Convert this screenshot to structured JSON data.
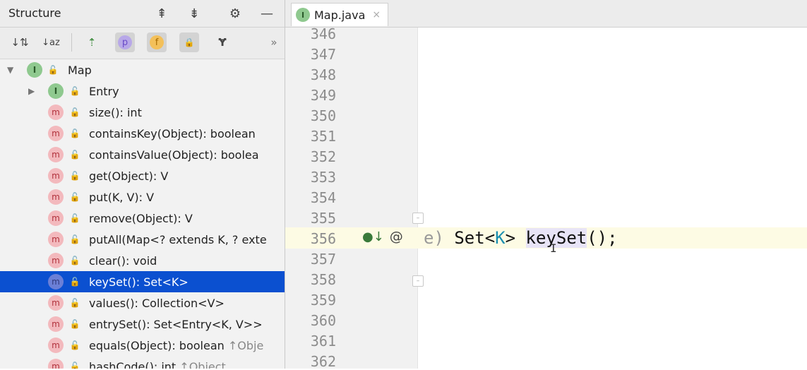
{
  "structure": {
    "title": "Structure",
    "header_icons": [
      "expand-all-icon",
      "collapse-all-icon",
      "gear-icon",
      "minimize-icon"
    ],
    "toolbar": {
      "sort_visibility": "sort-by-visibility-icon",
      "sort_alpha": "sort-alphabetically-icon",
      "show_inherited": "show-inherited-icon",
      "properties_label": "p",
      "fields_label": "f",
      "non_public_label": "lock-icon",
      "lambdas": "show-lambdas-icon",
      "more": "»"
    },
    "tree": [
      {
        "label": "Map",
        "kind": "interface",
        "expanded": true
      },
      {
        "label": "Entry",
        "kind": "interface",
        "expanded": false
      },
      {
        "label": "size(): int",
        "kind": "method"
      },
      {
        "label": "containsKey(Object): boolean",
        "kind": "method"
      },
      {
        "label": "containsValue(Object): boolea",
        "kind": "method"
      },
      {
        "label": "get(Object): V",
        "kind": "method"
      },
      {
        "label": "put(K, V): V",
        "kind": "method"
      },
      {
        "label": "remove(Object): V",
        "kind": "method"
      },
      {
        "label": "putAll(Map<? extends K, ? exte",
        "kind": "method"
      },
      {
        "label": "clear(): void",
        "kind": "method"
      },
      {
        "label": "keySet(): Set<K>",
        "kind": "method",
        "selected": true
      },
      {
        "label": "values(): Collection<V>",
        "kind": "method"
      },
      {
        "label": "entrySet(): Set<Entry<K, V>>",
        "kind": "method"
      },
      {
        "label": "equals(Object): boolean",
        "kind": "method",
        "hint": "↑Obje"
      },
      {
        "label": "hashCode(): int",
        "kind": "method",
        "hint": "↑Object"
      }
    ]
  },
  "editor": {
    "tab": {
      "label": "Map.java",
      "close": "×",
      "icon_letter": "I"
    },
    "line_numbers": [
      "346",
      "347",
      "348",
      "349",
      "350",
      "351",
      "352",
      "353",
      "354",
      "355",
      "356",
      "357",
      "358",
      "359",
      "360",
      "361",
      "362"
    ],
    "current_line": "356",
    "code": {
      "prefix": "e)",
      "set": "Set<",
      "type_param": "K",
      "close": "> ",
      "method": "keySet",
      "rest": "();"
    },
    "gutter_marks": {
      "implemented": "●↓",
      "annotation": "@"
    }
  },
  "colors": {
    "selection": "#0b50d0",
    "current_line": "#fdfbe4",
    "interface_icon": "#8fc98f",
    "method_icon": "#f3b9bd"
  }
}
